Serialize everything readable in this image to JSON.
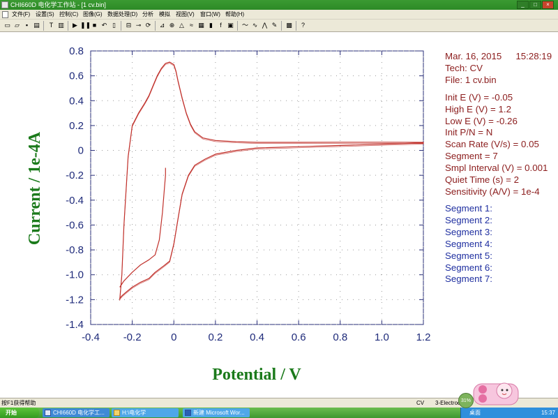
{
  "window": {
    "title": "CHI660D 电化学工作站 - [1 cv.bin]",
    "controls": [
      "_",
      "□",
      "×"
    ]
  },
  "menu": {
    "items": [
      "文件(F)",
      "设置(S)",
      "控制(C)",
      "图像(G)",
      "数据处理(D)",
      "分析",
      "模拟",
      "视图(V)",
      "窗口(W)",
      "帮助(H)"
    ]
  },
  "toolbar": {
    "icons": [
      "new-file-icon",
      "open-folder-icon",
      "save-icon",
      "print-icon",
      "text-icon",
      "technique-icon",
      "run-icon",
      "pause-icon",
      "stop-icon",
      "reverse-icon",
      "ir-comp-icon",
      "cell-icon",
      "filter-icon",
      "rotate-icon",
      "graph-icon",
      "zoom-icon",
      "peak-icon",
      "smooth-icon",
      "overlay-icon",
      "color-icon",
      "fp-icon",
      "derivative-icon",
      "convolution-icon",
      "simulation-icon",
      "calibration-icon",
      "info-icon",
      "help-icon"
    ]
  },
  "chart_data": {
    "type": "line",
    "xlabel": "Potential / V",
    "ylabel": "Current / 1e-4A",
    "xlim": [
      -0.4,
      1.2
    ],
    "ylim": [
      -1.4,
      0.8
    ],
    "x_ticks": [
      "-0.4",
      "-0.2",
      "0",
      "0.2",
      "0.4",
      "0.6",
      "0.8",
      "1.0",
      "1.2"
    ],
    "y_ticks": [
      "0.8",
      "0.6",
      "0.4",
      "0.2",
      "0",
      "-0.2",
      "-0.4",
      "-0.6",
      "-0.8",
      "-1.0",
      "-1.2",
      "-1.4"
    ],
    "grid": true,
    "series": [
      {
        "color": "#c0302a",
        "x": [
          -0.26,
          -0.25,
          -0.24,
          -0.22,
          -0.2,
          -0.17,
          -0.14,
          -0.12,
          -0.1,
          -0.08,
          -0.06,
          -0.04,
          -0.02,
          0.0,
          0.01,
          0.02,
          0.04,
          0.06,
          0.08,
          0.1,
          0.14,
          0.2,
          0.3,
          0.4,
          0.6,
          0.8,
          1.0,
          1.2,
          1.2,
          1.0,
          0.8,
          0.6,
          0.4,
          0.3,
          0.2,
          0.15,
          0.1,
          0.07,
          0.04,
          0.02,
          0.0,
          -0.02,
          -0.05,
          -0.09,
          -0.12,
          -0.16,
          -0.2,
          -0.23,
          -0.25,
          -0.26,
          -0.26
        ],
        "y": [
          -1.2,
          -1.0,
          -0.6,
          -0.05,
          0.2,
          0.3,
          0.38,
          0.44,
          0.52,
          0.6,
          0.66,
          0.7,
          0.71,
          0.69,
          0.64,
          0.56,
          0.42,
          0.3,
          0.21,
          0.15,
          0.1,
          0.08,
          0.07,
          0.065,
          0.065,
          0.066,
          0.066,
          0.065,
          0.06,
          0.05,
          0.04,
          0.03,
          0.02,
          0.0,
          -0.03,
          -0.07,
          -0.12,
          -0.2,
          -0.35,
          -0.55,
          -0.75,
          -0.89,
          -0.93,
          -0.98,
          -1.03,
          -1.06,
          -1.1,
          -1.14,
          -1.17,
          -1.19,
          -1.2
        ]
      },
      {
        "color": "#c0302a",
        "x": [
          -0.26,
          -0.24,
          -0.2,
          -0.16,
          -0.12,
          -0.09,
          -0.07,
          -0.055,
          -0.045,
          -0.04,
          -0.04
        ],
        "y": [
          -1.1,
          -1.05,
          -0.98,
          -0.92,
          -0.88,
          -0.84,
          -0.72,
          -0.5,
          -0.3,
          -0.2,
          -0.14
        ]
      }
    ]
  },
  "info": {
    "date": "Mar. 16, 2015",
    "time": "15:28:19",
    "tech": "Tech: CV",
    "file": "File: 1 cv.bin",
    "params": [
      "Init E (V) = -0.05",
      "High E (V) = 1.2",
      "Low E (V) = -0.26",
      "Init P/N = N",
      "Scan Rate (V/s) = 0.05",
      "Segment = 7",
      "Smpl Interval (V) = 0.001",
      "Quiet Time (s) = 2",
      "Sensitivity (A/V) = 1e-4"
    ],
    "segments": [
      "Segment 1:",
      "Segment 2:",
      "Segment 3:",
      "Segment 4:",
      "Segment 5:",
      "Segment 6:",
      "Segment 7:"
    ]
  },
  "status": {
    "help": "按F1获得帮助",
    "mode": "CV",
    "electrode": "3-Electrode"
  },
  "taskbar": {
    "start": "开始",
    "tasks": [
      "CHI660D 电化学工...",
      "H:\\电化学",
      "新建 Microsoft Wor..."
    ],
    "tray_label": "桌面",
    "clock": "15:37",
    "cpu": "31%"
  }
}
